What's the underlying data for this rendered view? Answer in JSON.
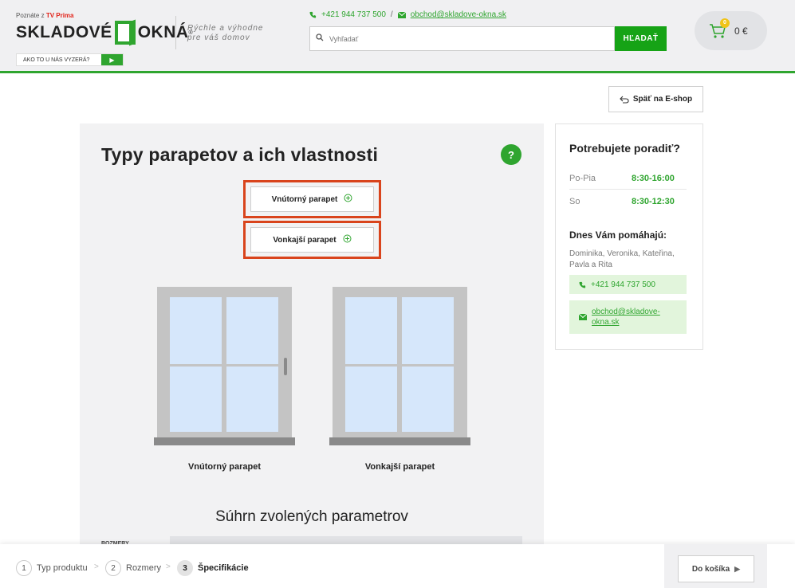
{
  "header": {
    "tv_prefix": "Poznáte z",
    "tv_brand": "TV Prima",
    "logo_left": "SKLADOVÉ",
    "logo_right": "OKNÁ",
    "logo_reg": "®",
    "ako_label": "AKO TO U NÁS VYZERÁ?",
    "ako_play": "▶",
    "tagline": "Rýchle a výhodne pre váš domov",
    "phone": "+421 944 737 500",
    "separator": "/",
    "email": "obchod@skladove-okna.sk",
    "search_placeholder": "Vyhľadať",
    "search_button": "HĽADAŤ",
    "cart_count": "0",
    "cart_price": "0 €"
  },
  "back_button": "Späť na E-shop",
  "main": {
    "title": "Typy parapetov a ich vlastnosti",
    "help": "?",
    "options": [
      {
        "label": "Vnútorný parapet"
      },
      {
        "label": "Vonkajší parapet"
      }
    ],
    "windows": [
      {
        "label": "Vnútorný parapet"
      },
      {
        "label": "Vonkajší parapet"
      }
    ],
    "summary_title": "Súhrn zvolených parametrov",
    "summary_key": "ROZMERY"
  },
  "sidebar": {
    "title": "Potrebujete poradiť?",
    "hours": [
      {
        "day": "Po-Pia",
        "time": "8:30-16:00"
      },
      {
        "day": "So",
        "time": "8:30-12:30"
      }
    ],
    "help_title": "Dnes Vám pomáhajú:",
    "names": "Dominika, Veronika, Kateřina, Pavla a Rita",
    "phone": "+421 944 737 500",
    "email": "obchod@skladove-okna.sk"
  },
  "footer": {
    "steps": [
      {
        "num": "1",
        "label": "Typ produktu"
      },
      {
        "num": "2",
        "label": "Rozmery"
      },
      {
        "num": "3",
        "label": "Špecifikácie"
      }
    ],
    "cart_button": "Do košíka",
    "cart_button_arrow": "▶"
  }
}
